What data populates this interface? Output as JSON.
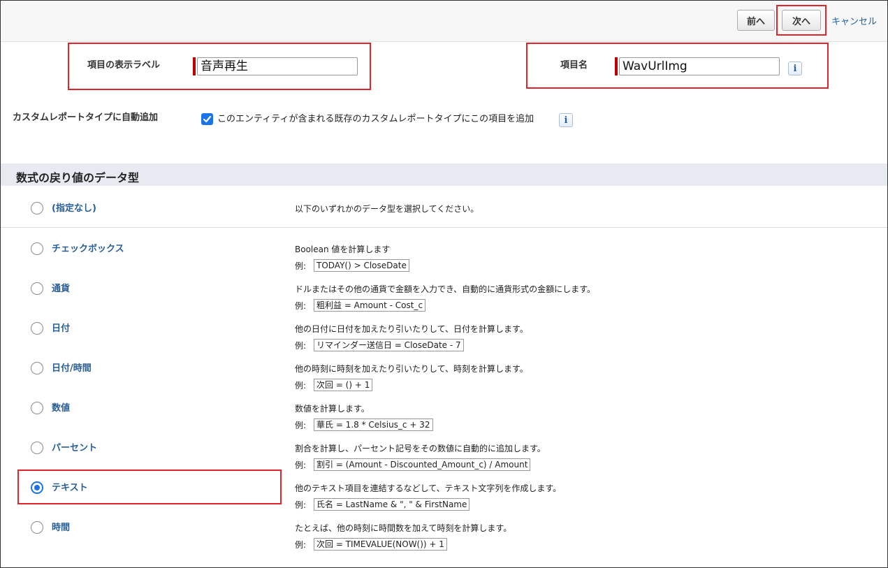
{
  "toolbar": {
    "prev_label": "前へ",
    "next_label": "次へ",
    "cancel_label": "キャンセル"
  },
  "fields": {
    "display_label": {
      "label": "項目の表示ラベル",
      "value": "音声再生"
    },
    "field_name": {
      "label": "項目名",
      "value": "WavUrlImg"
    },
    "info_icon_text": "i"
  },
  "auto_add": {
    "label": "カスタムレポートタイプに自動追加",
    "checked": true,
    "checkbox_text": "このエンティティが含まれる既存のカスタムレポートタイプにこの項目を追加"
  },
  "section": {
    "title": "数式の戻り値のデータ型"
  },
  "example_prefix": "例:",
  "options": [
    {
      "label": "(指定なし)",
      "selected": false,
      "description": "以下のいずれかのデータ型を選択してください。",
      "example": ""
    },
    {
      "label": "チェックボックス",
      "selected": false,
      "description": "Boolean 値を計算します",
      "example": "TODAY() > CloseDate"
    },
    {
      "label": "通貨",
      "selected": false,
      "description": "ドルまたはその他の通貨で金額を入力でき、自動的に通貨形式の金額にします。",
      "example": "粗利益 = Amount - Cost_c"
    },
    {
      "label": "日付",
      "selected": false,
      "description": "他の日付に日付を加えたり引いたりして、日付を計算します。",
      "example": "リマインダー送信日 = CloseDate - 7"
    },
    {
      "label": "日付/時間",
      "selected": false,
      "description": "他の時刻に時刻を加えたり引いたりして、時刻を計算します。",
      "example": "次回 = () + 1"
    },
    {
      "label": "数値",
      "selected": false,
      "description": "数値を計算します。",
      "example": "華氏 = 1.8 * Celsius_c + 32"
    },
    {
      "label": "パーセント",
      "selected": false,
      "description": "割合を計算し、パーセント記号をその数値に自動的に追加します。",
      "example": "割引 = (Amount - Discounted_Amount_c) / Amount"
    },
    {
      "label": "テキスト",
      "selected": true,
      "description": "他のテキスト項目を連結するなどして、テキスト文字列を作成します。",
      "example": "氏名 = LastName & \", \" & FirstName"
    },
    {
      "label": "時間",
      "selected": false,
      "description": "たとえば、他の時刻に時間数を加えて時刻を計算します。",
      "example": "次回 = TIMEVALUE(NOW()) + 1"
    }
  ],
  "colors": {
    "highlight": "#e0242a",
    "accent": "#1a73e8",
    "link": "#2a5e97",
    "section_bg": "#e7eaf1"
  }
}
